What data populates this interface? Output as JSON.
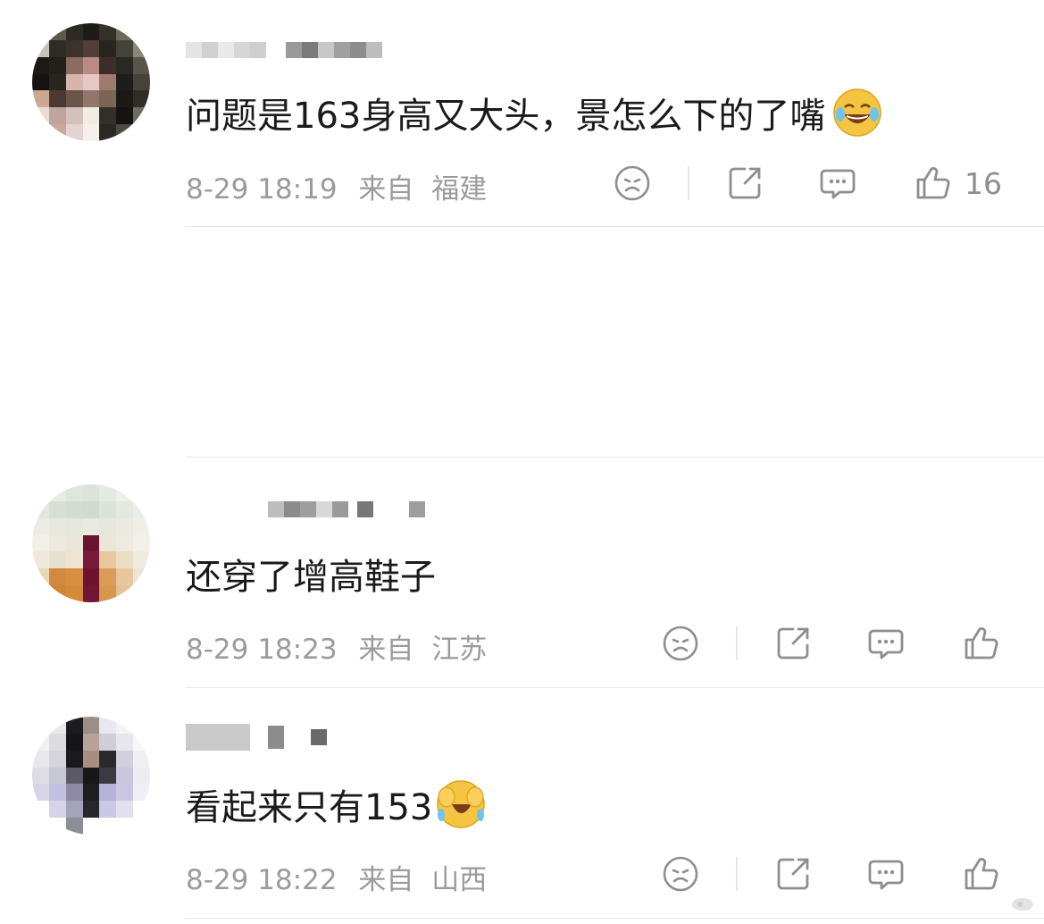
{
  "comments": [
    {
      "text": "问题是163身高又大头，景怎么下的了嘴",
      "emoji": "laughing-tears-emoji",
      "time": "8-29 18:19",
      "from_label": "来自",
      "location": "福建",
      "like_count": "16"
    },
    {
      "text": "还穿了增高鞋子",
      "emoji": "",
      "time": "8-29 18:23",
      "from_label": "来自",
      "location": "江苏",
      "like_count": ""
    },
    {
      "text": "看起来只有153",
      "emoji": "crying-laughing-covering-face-emoji",
      "time": "8-29 18:22",
      "from_label": "来自",
      "location": "山西",
      "like_count": ""
    }
  ],
  "icons": {
    "dislike": "sad-face-icon",
    "share": "share-icon",
    "reply": "comment-bubble-icon",
    "like": "thumbs-up-icon"
  },
  "colors": {
    "text": "#1a1a1a",
    "meta": "#9b9b9b",
    "icon": "#8e8e8e",
    "emoji_yellow": "#f5c542"
  }
}
